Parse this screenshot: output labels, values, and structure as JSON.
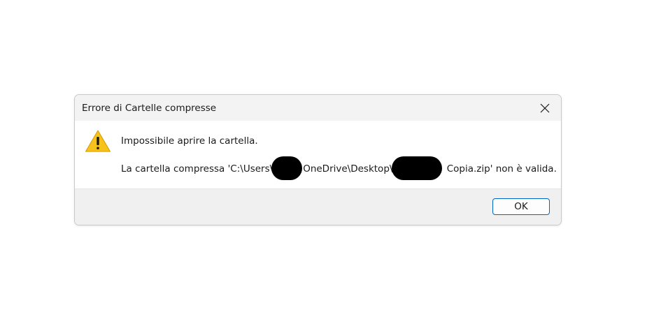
{
  "dialog": {
    "title": "Errore di Cartelle compresse",
    "close_icon": "close-icon",
    "icon": "warning-icon",
    "message": "Impossibile aprire la cartella.",
    "detail": {
      "part1": "La cartella compressa 'C:\\Users\\",
      "part2": "OneDrive\\Desktop\\",
      "part3": " Copia.zip' non è valida."
    },
    "ok_label": "OK"
  },
  "colors": {
    "title_bar": "#f3f3f3",
    "footer": "#f0f0f0",
    "button_border": "#0067c0",
    "warning_fill": "#f8c21c",
    "redaction": "#000000"
  }
}
